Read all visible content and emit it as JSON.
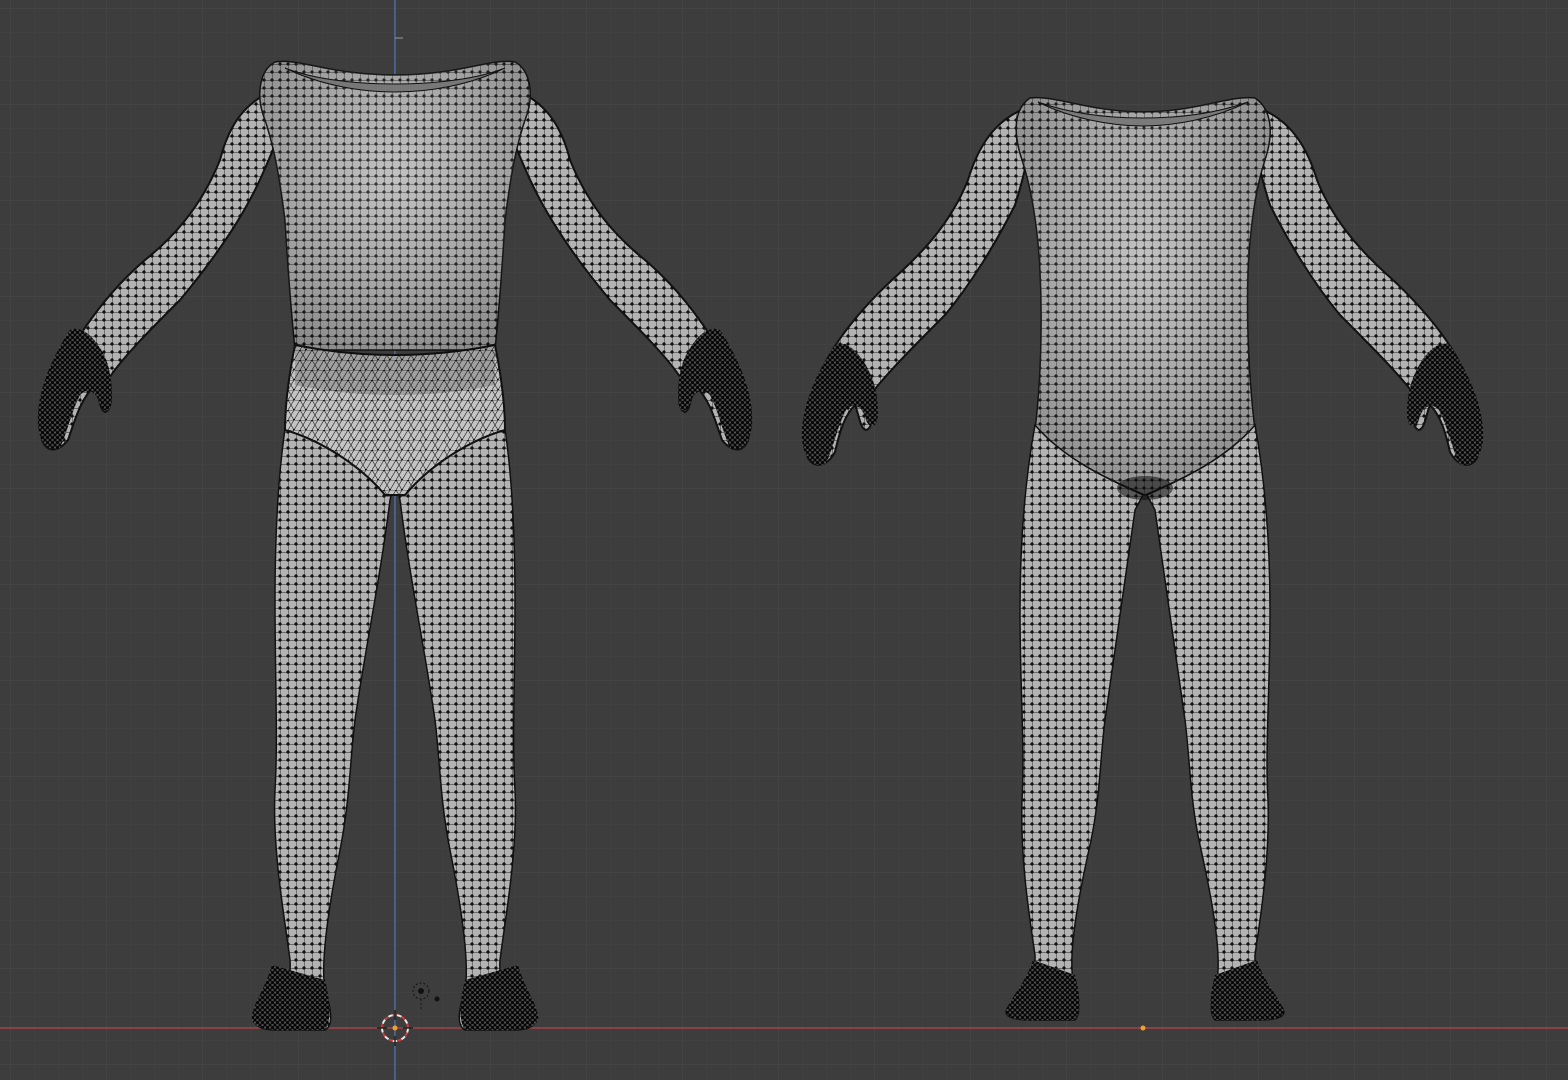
{
  "viewport": {
    "background": "#3d3d3d",
    "grid_minor": "#434343",
    "grid_major": "#4c4c4c",
    "x_axis_color": "#b5454d",
    "z_axis_color": "#4a74b8",
    "mesh_fill": "#a8a8a8",
    "mesh_highlight": "#c9c9c9",
    "wire_color": "#1a1a1a",
    "vertex_color": "#0d0d0d"
  },
  "objects": [
    {
      "name": "body-mesh-with-underwear",
      "description_icon": "wireframe-mesh-icon"
    },
    {
      "name": "body-mesh-clean",
      "description_icon": "wireframe-mesh-icon"
    }
  ],
  "gizmos": {
    "cursor_icon": "3d-cursor-icon",
    "camera_icon": "light-gizmo-icon",
    "origin_icon": "object-origin-icon"
  }
}
